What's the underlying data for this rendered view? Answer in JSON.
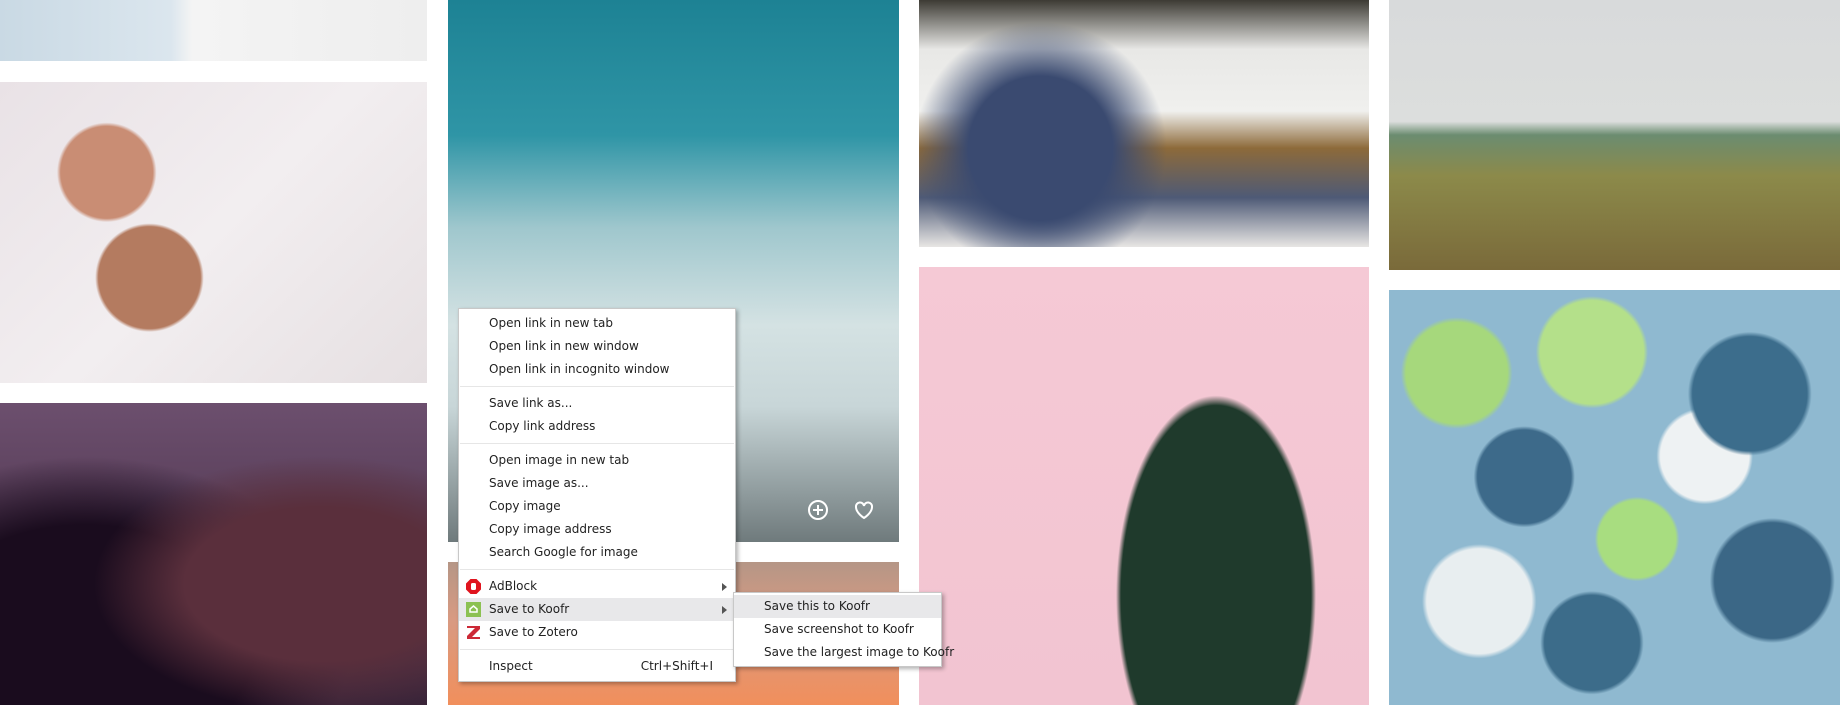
{
  "context_menu": {
    "groups": [
      [
        "Open link in new tab",
        "Open link in new window",
        "Open link in incognito window"
      ],
      [
        "Save link as...",
        "Copy link address"
      ],
      [
        "Open image in new tab",
        "Save image as...",
        "Copy image",
        "Copy image address",
        "Search Google for image"
      ]
    ],
    "extensions": [
      {
        "label": "AdBlock",
        "icon": "adblock-hand-icon",
        "color": "#e0141e"
      },
      {
        "label": "Save to Koofr",
        "icon": "koofr-icon",
        "color": "#8cc152"
      },
      {
        "label": "Save to Zotero",
        "icon": "zotero-z-icon",
        "color": "#cc2936"
      }
    ],
    "inspect": {
      "label": "Inspect",
      "shortcut": "Ctrl+Shift+I"
    }
  },
  "koofr_submenu": [
    "Save this to Koofr",
    "Save screenshot to Koofr",
    "Save the largest image to Koofr"
  ],
  "tile_actions": {
    "add": "plus-circle-icon",
    "like": "heart-icon"
  }
}
